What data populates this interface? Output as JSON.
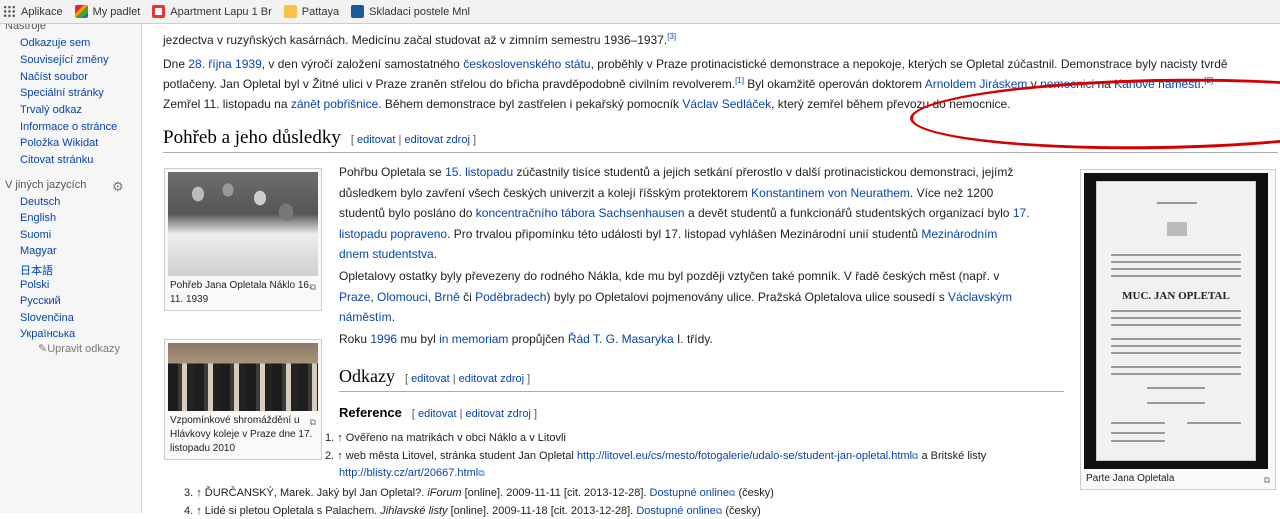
{
  "bookmarks": [
    {
      "label": "Aplikace",
      "icon": "apps-grid-icon"
    },
    {
      "label": "My padlet",
      "icon": "padlet-icon"
    },
    {
      "label": "Apartment Lapu 1 Br",
      "icon": "opera-icon"
    },
    {
      "label": "Pattaya",
      "icon": "folder-icon"
    },
    {
      "label": "Skladaci postele Mnl",
      "icon": "bookmark-page-icon"
    }
  ],
  "sidebar": {
    "tools": [
      "Nástroje",
      "Odkazuje sem",
      "Související změny",
      "Načíst soubor",
      "Speciální stránky",
      "Trvalý odkaz",
      "Informace o stránce",
      "Položka Wikidat",
      "Citovat stránku"
    ],
    "languages_heading": "V jiných jazycích",
    "languages": [
      "Deutsch",
      "English",
      "Suomi",
      "Magyar",
      "日本語",
      "Polski",
      "Русский",
      "Slovenčina",
      "Українська"
    ],
    "edit_links": "Upravit odkazy"
  },
  "content": {
    "p0_text": "jezdectva v ruzyňských kasárnách. Medicínu začal studovat až v zimním semestru 1936–1937.",
    "p0_sup": "[3]",
    "p1": {
      "a": "Dne ",
      "link1": "28. října 1939",
      "b": ", v den výročí založení samostatného ",
      "link2": "československého státu",
      "c": ", proběhly v Praze protinacistické demonstrace a nepokoje, kterých se Opletal zúčastnil. Demonstrace byly nacisty tvrdě",
      "d": "potlačeny. Jan Opletal byl v Žitné ulici v Praze zraněn střelou do břicha pravděpodobně civilním revolverem.",
      "sup1": "[1]",
      "e": " Byl okamžitě operován doktorem ",
      "link3": "Arnoldem Jiráskem",
      "f": " v ",
      "link4": "nemocnici",
      "g": " na ",
      "link5": "Karlově náměstí",
      "h": ".",
      "sup2": "[2]",
      "i": "Zemřel 11. listopadu na ",
      "link6": "zánět pobřišnice",
      "j": ". Během demonstrace byl zastřelen i pekařský pomocník ",
      "link7": "Václav Sedláček",
      "k": ", který zemřel během převozu do nemocnice."
    },
    "section1_title": "Pohřeb a jeho důsledky",
    "edit": "editovat",
    "edit_source": "editovat zdroj",
    "p2": {
      "a": "Pohřbu Opletala se ",
      "link1": "15. listopadu",
      "b": " zúčastnily tisíce studentů a jejich setkání přerostlo v další protinacistickou demonstraci, jejímž",
      "c": "důsledkem bylo zavření všech českých univerzit a kolejí říšským protektorem ",
      "link2": "Konstantinem von Neurathem",
      "d": ". Více než 1200",
      "e": "studentů bylo posláno do ",
      "link3": "koncentračního tábora Sachsenhausen",
      "f": " a devět studentů a funkcionářů studentských organizací bylo ",
      "link4a": "17.",
      "link4b": "listopadu popraveno",
      "g": ". Pro trvalou připomínku této události byl 17. listopad vyhlášen Mezinárodní unií studentů ",
      "link5a": "Mezinárodním",
      "link5b": "dnem studentstva",
      "h": "."
    },
    "p3": {
      "a": "Opletalovy ostatky byly převezeny do rodného Nákla, kde mu byl později vztyčen také pomník. V řadě českých měst (např. v",
      "link1": "Praze",
      "b": ", ",
      "link2": "Olomouci",
      "c": ", ",
      "link3": "Brně",
      "d": " či ",
      "link4": "Poděbradech",
      "e": ") byly po Opletalovi pojmenovány ulice. Pražská Opletalova ulice sousedí s ",
      "link5a": "Václavským",
      "link5b": "náměstím",
      "f": "."
    },
    "p4": {
      "a": "Roku ",
      "link1": "1996",
      "b": " mu byl ",
      "link2": "in memoriam",
      "c": " propůjčen ",
      "link3": "Řád T. G. Masaryka",
      "d": " I. třídy."
    },
    "section2_title": "Odkazy",
    "section3_title": "Reference",
    "thumb1_caption": "Pohřeb Jana Opletala Náklo 16. 11. 1939",
    "thumb2_caption": "Vzpomínkové shromáždění u Hlávkovy koleje v Praze dne 17. listopadu 2010",
    "thumb3_caption": "Parte Jana Opletala",
    "parte_name": "MUC. JAN OPLETAL",
    "refs": [
      {
        "n": "1.",
        "text": "↑ Ověřeno na matrikách v obci Náklo a v Litovli"
      },
      {
        "n": "2.",
        "a": "↑ web města Litovel, stránka student Jan Opletal ",
        "url1": "http://litovel.eu/cs/mesto/fotogalerie/udalo-se/student-jan-opletal.html",
        "b": " a Britské listy",
        "url2": "http://blisty.cz/art/20667.html"
      },
      {
        "n": "3.",
        "a": "↑ ĎURČANSKÝ, Marek. Jaký byl Jan Opletal?. ",
        "i": "iForum",
        "b": " [online]. 2009-11-11 [cit. 2013-12-28]. ",
        "link": "Dostupné online",
        "c": " (česky)"
      },
      {
        "n": "4.",
        "a": "↑ Lidé si pletou Opletala s Palachem. ",
        "i": "Jihlavské listy",
        "b": " [online]. 2009-11-18 [cit. 2013-12-28]. ",
        "link": "Dostupné online",
        "c": " (česky)"
      }
    ]
  },
  "colors": {
    "link": "#0645ad",
    "annotation": "#d40000",
    "sidebar_bg": "#f6f6f6"
  }
}
